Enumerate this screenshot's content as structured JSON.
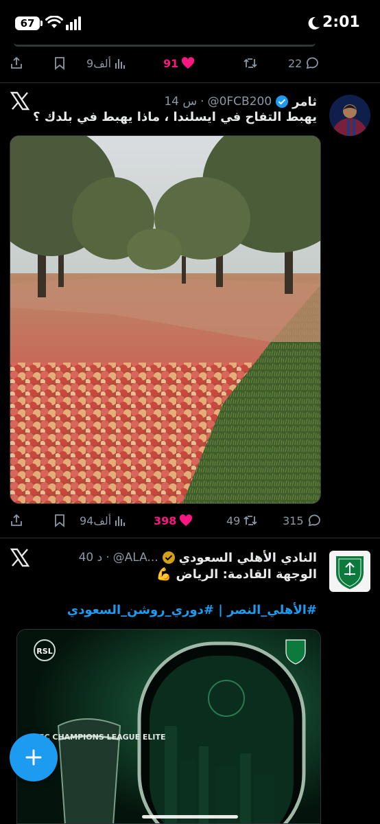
{
  "status_bar": {
    "battery": "67",
    "time": "2:01"
  },
  "top_tweet_actions": {
    "replies": "22",
    "likes": "91",
    "views": "9ألف"
  },
  "tweet1": {
    "name": "ثامر",
    "handle": "@0FCB200",
    "time": "14 س",
    "text": "يهبط التفاح في ايسلندا ، ماذا يهبط في بلدك ؟",
    "replies": "315",
    "retweets": "49",
    "likes": "398",
    "views": "94ألف"
  },
  "tweet2": {
    "name": "النادي الأهلي السعودي",
    "handle": "@ALA...",
    "time": "40 د",
    "text": "الوجهة القادمة: الرياض 💪",
    "hashtags": "#الأهلي_النصر | #دوري_روشن_السعودي",
    "media_banner": "AFC CHAMPIONS LEAGUE ELITE",
    "rsl_logo": "RSL"
  },
  "colors": {
    "like": "#f91880",
    "link": "#1d9bf0",
    "muted": "#8b98a5",
    "verified": "#1d9bf0",
    "gold": "#d4a017"
  }
}
